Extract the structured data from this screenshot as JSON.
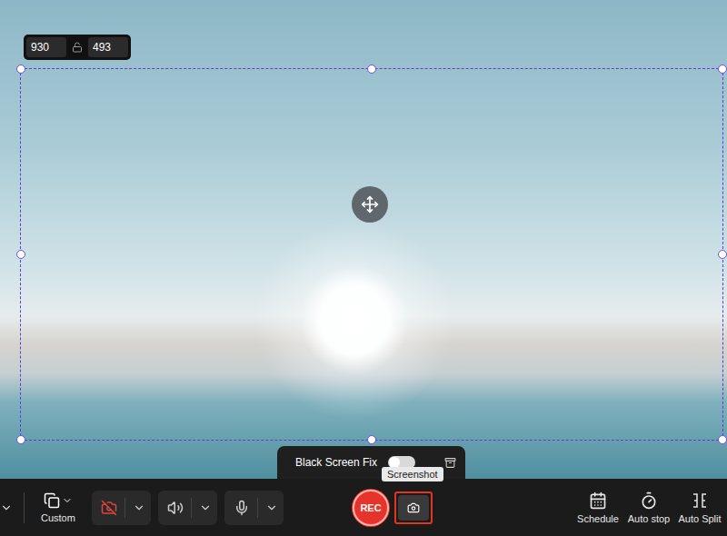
{
  "selection": {
    "width": "930",
    "height": "493",
    "locked": false
  },
  "black_screen_fix": {
    "label": "Black Screen Fix",
    "on": false
  },
  "tooltip": {
    "text": "Screenshot"
  },
  "toolbar": {
    "region": {
      "label": "Custom"
    },
    "webcam": {
      "on": false
    },
    "system_audio": {
      "on": true
    },
    "microphone": {
      "on": true
    },
    "rec_button": {
      "label": "REC"
    },
    "screenshot_button": {
      "highlighted": true
    },
    "actions": [
      {
        "label": "Schedule"
      },
      {
        "label": "Auto stop"
      },
      {
        "label": "Auto Split"
      }
    ]
  }
}
